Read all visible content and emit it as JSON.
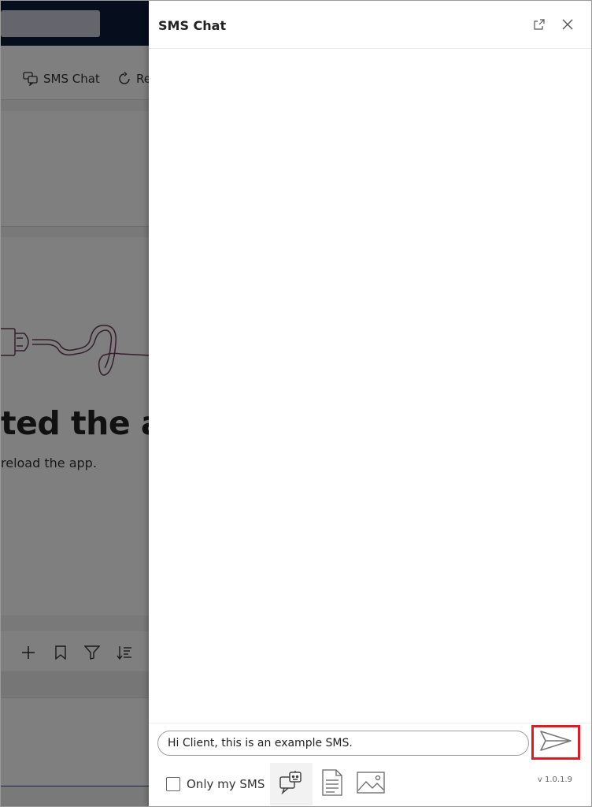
{
  "background_app": {
    "toolbar": {
      "sms_chat_label": "SMS Chat",
      "refresh_label": "Re"
    },
    "error": {
      "title": "ted the ap",
      "subtitle": "reload the app."
    },
    "icons": [
      "chat-icon",
      "refresh-icon",
      "plus-icon",
      "bookmark-icon",
      "filter-icon",
      "sort-icon"
    ]
  },
  "panel": {
    "title": "SMS Chat",
    "popout_icon": "popout-icon",
    "close_icon": "close-icon"
  },
  "composer": {
    "message_value": "Hi Client, this is an example SMS.",
    "send_icon": "send-icon",
    "only_my_sms_label": "Only my SMS",
    "only_my_sms_checked": false,
    "tools": [
      "bot-chat-icon",
      "document-icon",
      "image-icon"
    ],
    "version": "v 1.0.1.9"
  },
  "colors": {
    "header_dark": "#0d1a3a",
    "highlight": "#e01b22",
    "text": "#222222"
  }
}
